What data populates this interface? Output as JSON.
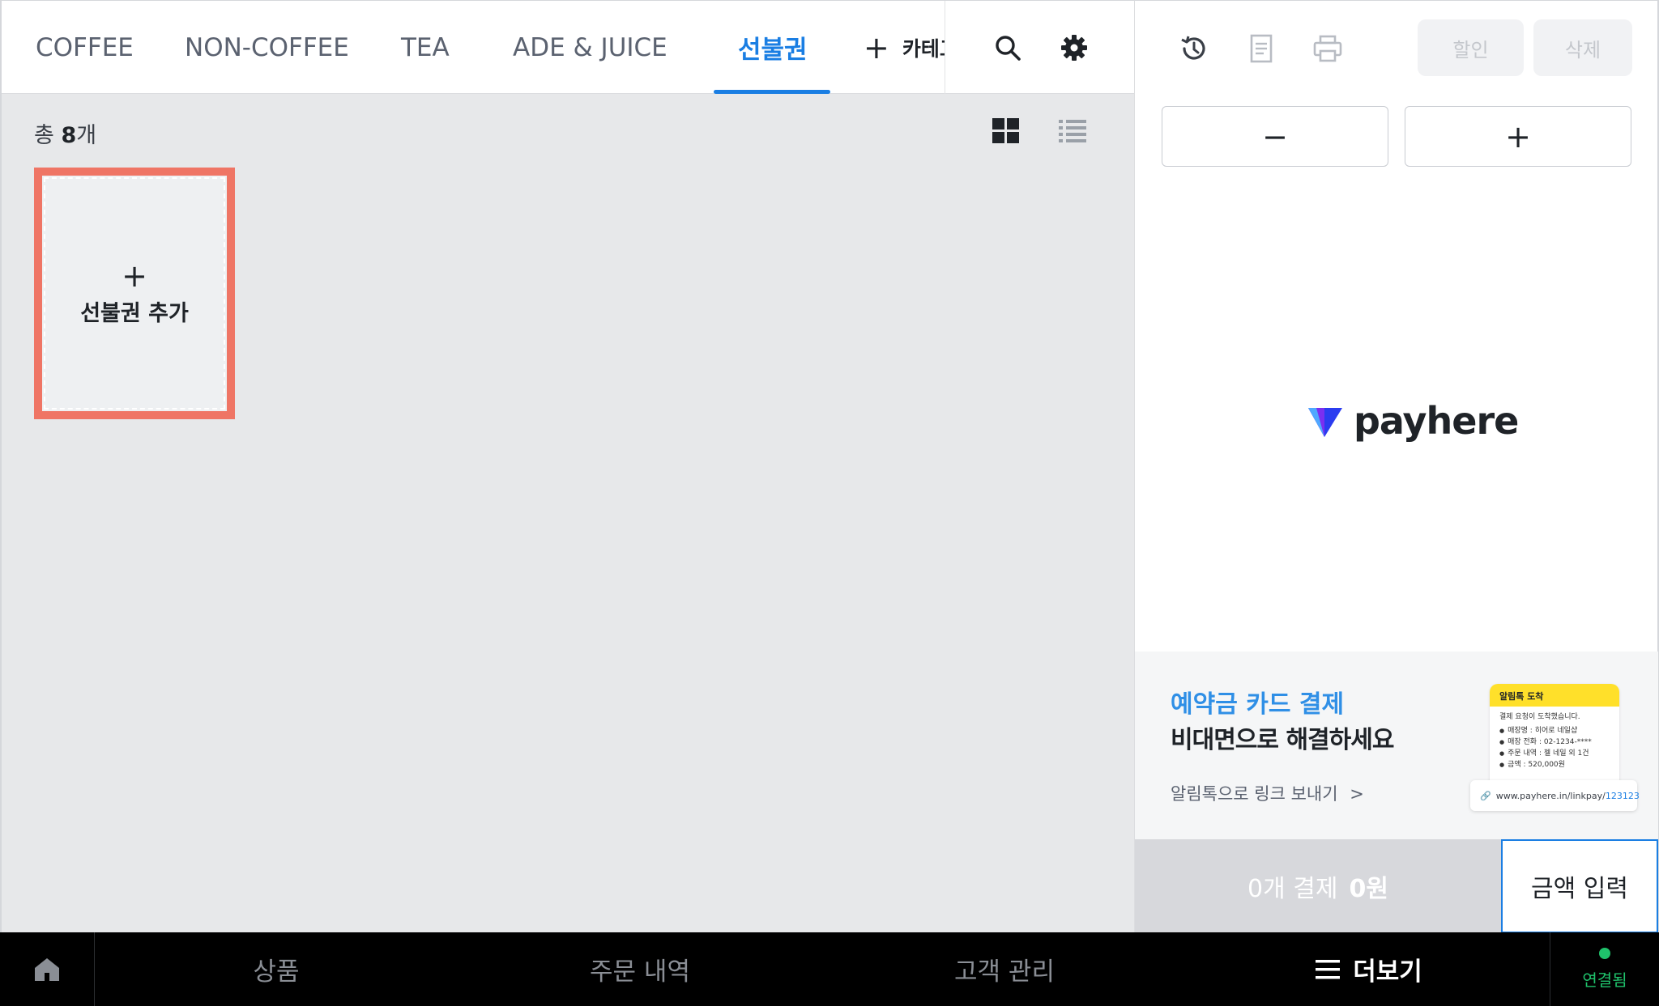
{
  "categories": {
    "tabs": [
      {
        "label": "COFFEE"
      },
      {
        "label": "NON-COFFEE"
      },
      {
        "label": "TEA"
      },
      {
        "label": "ADE & JUICE"
      },
      {
        "label": "선불권"
      }
    ],
    "active_tab": "선불권",
    "add_category_label": "카테고리 추가",
    "search_icon": "search-icon",
    "settings_icon": "gear-icon"
  },
  "summary": {
    "count_prefix": "총",
    "count_value": "8",
    "count_suffix": "개",
    "view_modes": [
      "grid-view-icon",
      "list-view-icon"
    ]
  },
  "add_card": {
    "plus": "+",
    "label": "선불권 추가"
  },
  "order_panel": {
    "toolbar_icons": [
      "history-icon",
      "document-icon",
      "printer-icon"
    ],
    "discount_label": "할인",
    "delete_label": "삭제",
    "minus_label": "−",
    "plus_label": "+",
    "brand": "payhere"
  },
  "banner": {
    "headline_blue": "예약금 카드 결제",
    "headline_black": "비대면으로 해결하세요",
    "link_label": "알림톡으로 링크 보내기",
    "link_arrow": ">",
    "preview": {
      "title": "알림톡 도착",
      "line1": "결제 요청이 도착했습니다.",
      "items": [
        "매장명 : 히어로 네일샵",
        "매장 전화 : 02-1234-****",
        "주문 내역 : 젤 네일 외 1건",
        "금액 : 520,000원"
      ],
      "url_prefix": "www.payhere.in/linkpay/",
      "url_id": "123123"
    }
  },
  "payment": {
    "pay_label": "0개 결제",
    "pay_amount": "0원",
    "amount_input_label": "금액 입력"
  },
  "bottom_nav": {
    "home_icon": "home-icon",
    "items": [
      "상품",
      "주문 내역",
      "고객 관리"
    ],
    "more_label": "더보기",
    "status_label": "연결됨"
  },
  "colors": {
    "accent": "#1a7ee3",
    "add_card_border": "#ef7565",
    "status_green": "#1fc26b"
  }
}
